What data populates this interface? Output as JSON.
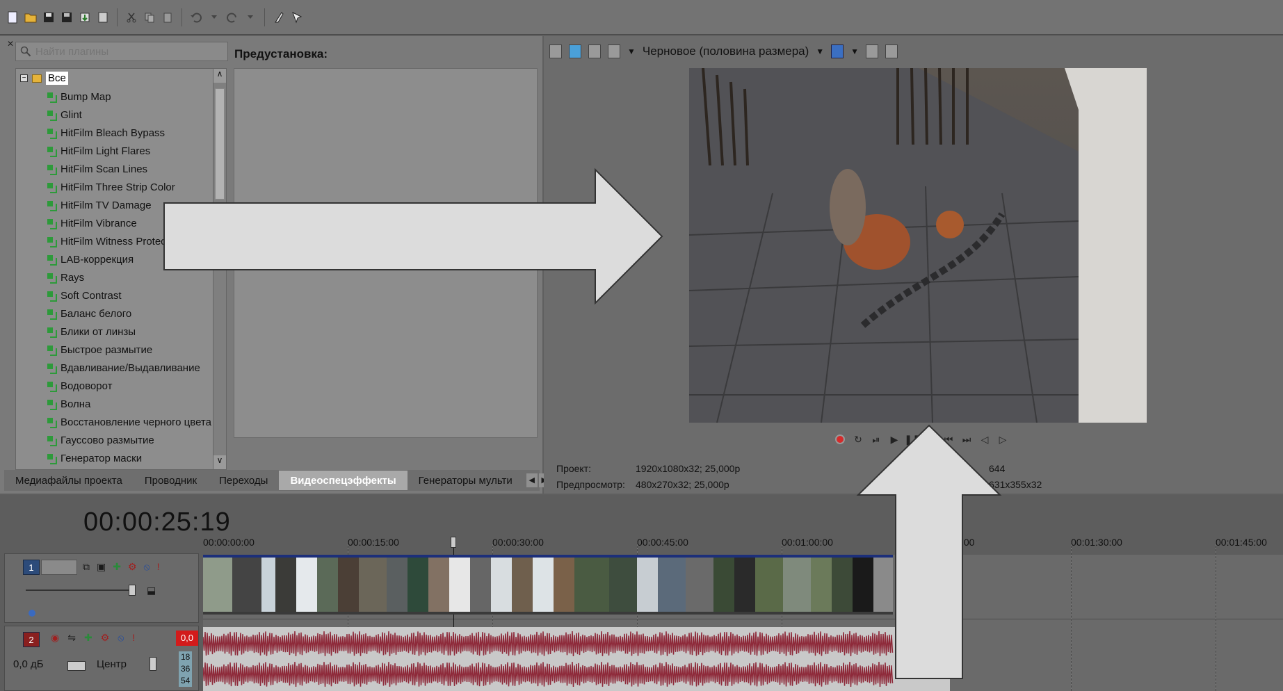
{
  "plugins": {
    "search_placeholder": "Найти плагины",
    "root": "Все",
    "items": [
      "Bump Map",
      "Glint",
      "HitFilm Bleach Bypass",
      "HitFilm Light Flares",
      "HitFilm Scan Lines",
      "HitFilm Three Strip Color",
      "HitFilm TV Damage",
      "HitFilm Vibrance",
      "HitFilm Witness Protectio",
      "LAB-коррекция",
      "Rays",
      "Soft Contrast",
      "Баланс белого",
      "Блики от линзы",
      "Быстрое размытие",
      "Вдавливание/Выдавливание",
      "Водоворот",
      "Волна",
      "Восстановление черного цвета",
      "Гауссово размытие",
      "Генератор маски"
    ]
  },
  "preset": {
    "label": "Предустановка:"
  },
  "tabs": [
    {
      "label": "Медиафайлы проекта",
      "active": false
    },
    {
      "label": "Проводник",
      "active": false
    },
    {
      "label": "Переходы",
      "active": false
    },
    {
      "label": "Видеоспецэффекты",
      "active": true
    },
    {
      "label": "Генераторы мульти",
      "active": false
    }
  ],
  "preview": {
    "quality": "Черновое (половина размера)",
    "project_label": "Проект:",
    "project_value": "1920x1080x32; 25,000p",
    "preview_label": "Предпросмотр:",
    "preview_value": "480x270x32; 25,000p",
    "right_value_1": "644",
    "right_value_2": "631x355x32"
  },
  "timeline": {
    "timecode": "00:00:25:19",
    "ticks": [
      "00:00:00:00",
      "00:00:15:00",
      "00:00:30:00",
      "00:00:45:00",
      "00:01:00:00",
      ":00",
      "00:01:30:00",
      "00:01:45:00"
    ],
    "video_track_num": "1",
    "audio_track_num": "2",
    "volume": "0,0 дБ",
    "pan": "Центр",
    "level_badge": "0,0",
    "level_marks": [
      "18",
      "36",
      "54"
    ]
  },
  "colors": {
    "accent_blue": "#4aa0d9",
    "audio_wave": "#8e2a3a",
    "record_red": "#d42b2b"
  }
}
